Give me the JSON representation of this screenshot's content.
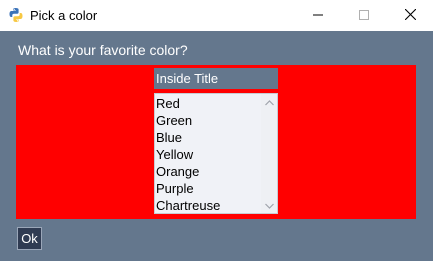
{
  "window": {
    "title": "Pick a color"
  },
  "prompt": "What is your favorite color?",
  "frame": {
    "title": "Inside Title",
    "background_color": "#ff0000"
  },
  "listbox": {
    "items": [
      "Red",
      "Green",
      "Blue",
      "Yellow",
      "Orange",
      "Purple",
      "Chartreuse"
    ]
  },
  "buttons": {
    "ok_label": "Ok"
  },
  "theme": {
    "window_background": "#64778d",
    "button_background": "#2f3b52",
    "text_color": "#ffffff"
  },
  "icons": {
    "app": "python-icon",
    "minimize": "minimize-icon",
    "maximize": "maximize-icon",
    "close": "close-icon",
    "scroll_up": "chevron-up-icon",
    "scroll_down": "chevron-down-icon"
  }
}
